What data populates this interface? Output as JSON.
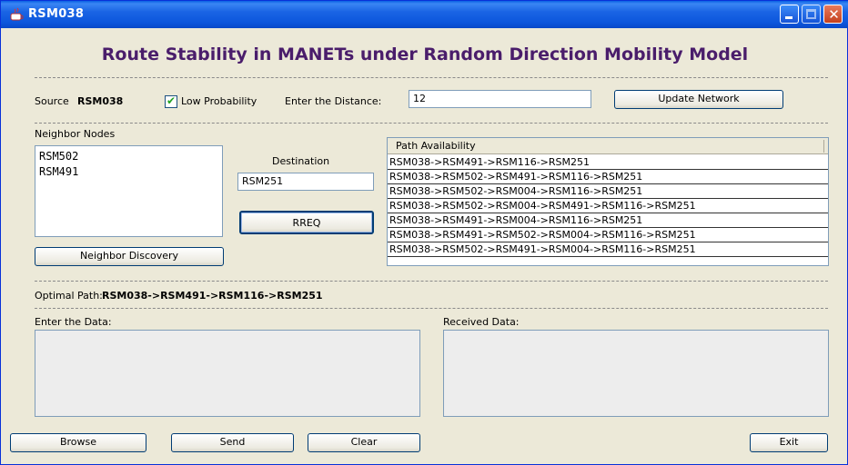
{
  "window": {
    "title": "RSM038"
  },
  "heading": "Route Stability in MANETs under Random Direction Mobility Model",
  "source": {
    "label": "Source",
    "value": "RSM038"
  },
  "low_probability": {
    "label": "Low Probability",
    "checked": true
  },
  "distance": {
    "label": "Enter the Distance:",
    "value": "12"
  },
  "update_network_label": "Update Network",
  "neighbor_nodes": {
    "label": "Neighbor Nodes",
    "items": [
      "RSM502",
      "RSM491"
    ]
  },
  "destination": {
    "label": "Destination",
    "value": "RSM251"
  },
  "rreq_label": "RREQ",
  "neighbor_discovery_label": "Neighbor Discovery",
  "path_availability": {
    "header": "Path Availability",
    "rows": [
      "RSM038->RSM491->RSM116->RSM251",
      "RSM038->RSM502->RSM491->RSM116->RSM251",
      "RSM038->RSM502->RSM004->RSM116->RSM251",
      "RSM038->RSM502->RSM004->RSM491->RSM116->RSM251",
      "RSM038->RSM491->RSM004->RSM116->RSM251",
      "RSM038->RSM491->RSM502->RSM004->RSM116->RSM251",
      "RSM038->RSM502->RSM491->RSM004->RSM116->RSM251"
    ]
  },
  "optimal_path": {
    "label": "Optimal Path:",
    "value": "RSM038->RSM491->RSM116->RSM251"
  },
  "enter_data_label": "Enter the Data:",
  "received_data_label": "Received Data:",
  "buttons": {
    "browse": "Browse",
    "send": "Send",
    "clear": "Clear",
    "exit": "Exit"
  },
  "colors": {
    "heading": "#4A1D6B",
    "titlebar": "#0C56DC",
    "window_bg": "#ECE9D8"
  }
}
